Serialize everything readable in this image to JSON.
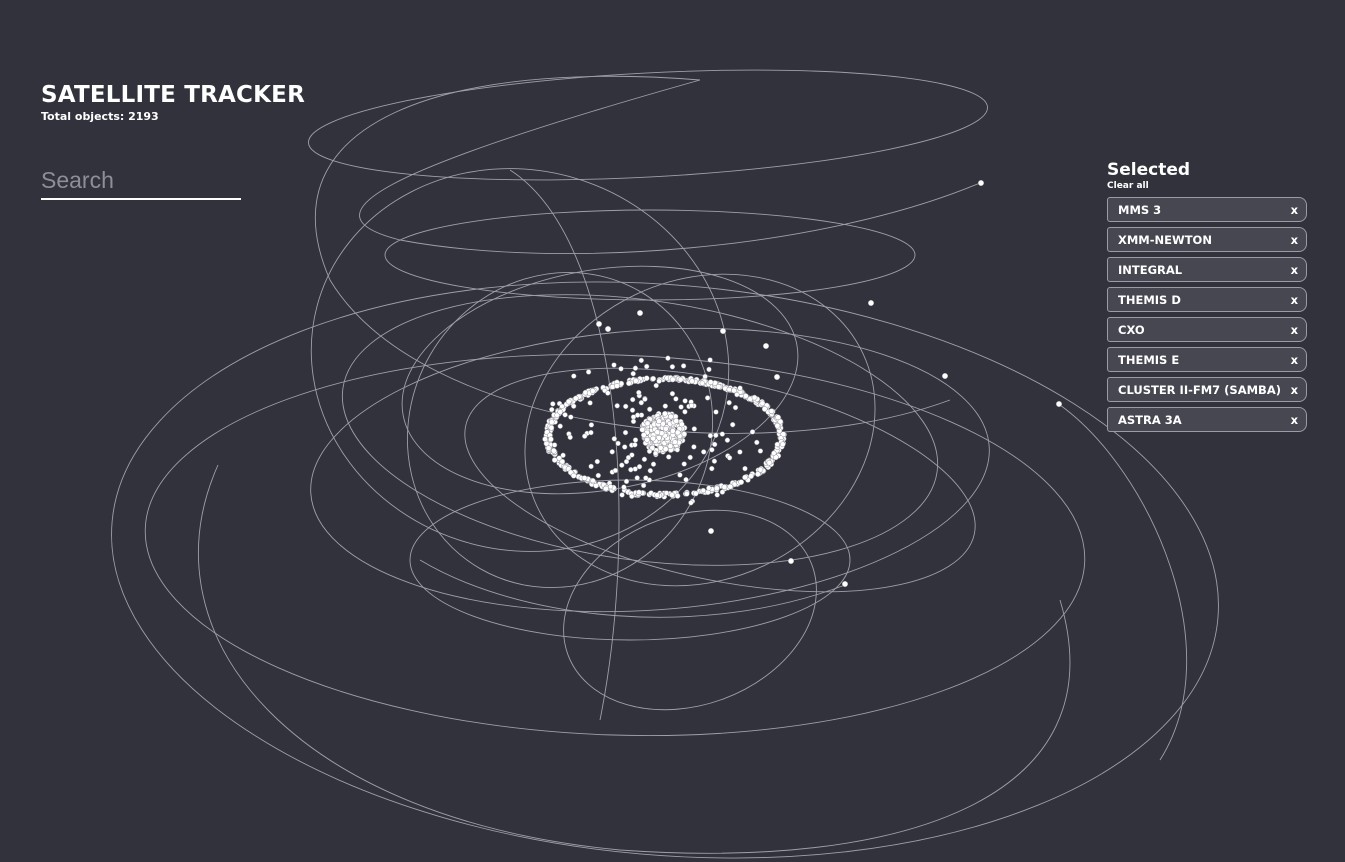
{
  "header": {
    "title": "SATELLITE TRACKER",
    "total_label": "Total objects: 2193"
  },
  "search": {
    "placeholder": "Search",
    "value": ""
  },
  "selected": {
    "title": "Selected",
    "clear_all_label": "Clear all",
    "remove_label": "x",
    "items": [
      "MMS 3",
      "XMM-NEWTON",
      "INTEGRAL",
      "THEMIS D",
      "CXO",
      "THEMIS E",
      "CLUSTER II-FM7 (SAMBA)",
      "ASTRA 3A"
    ]
  },
  "colors": {
    "background": "#32323d",
    "orbit_line": "#b4b4be",
    "satellite_dot": "#ffffff",
    "chip_background": "#474752",
    "chip_border": "#9b9ba6"
  }
}
